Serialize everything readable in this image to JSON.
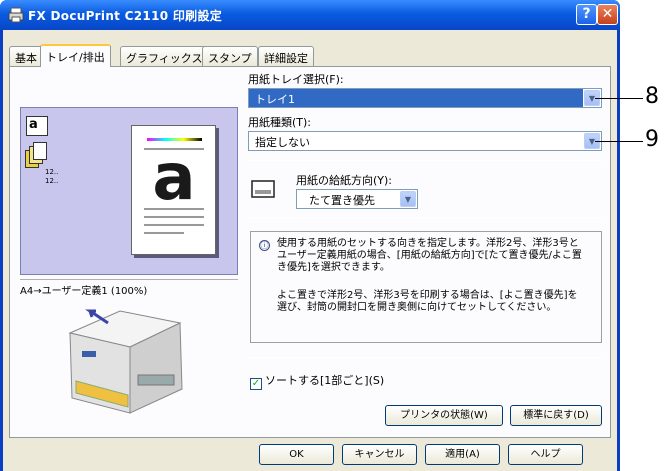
{
  "window": {
    "title": "FX DocuPrint C2110 印刷設定",
    "help_button": "?",
    "close_button": "✕"
  },
  "tabs": [
    {
      "label": "基本",
      "active": false
    },
    {
      "label": "トレイ/排出",
      "active": true
    },
    {
      "label": "グラフィックス",
      "active": false
    },
    {
      "label": "スタンプ",
      "active": false
    },
    {
      "label": "詳細設定",
      "active": false
    }
  ],
  "preview": {
    "caption": "A4→ユーザー定義1 (100%)",
    "big_letter": "a",
    "small_labels": [
      "12..",
      "12.."
    ]
  },
  "paper_tray": {
    "label": "用紙トレイ選択(F):",
    "value": "トレイ1"
  },
  "paper_type": {
    "label": "用紙種類(T):",
    "value": "指定しない"
  },
  "feed_direction": {
    "label": "用紙の給紙方向(Y):",
    "value": "たて置き優先"
  },
  "info": {
    "icon": "ⓘ",
    "paragraph1": "使用する用紙のセットする向きを指定します。洋形2号、洋形3号とユーザー定義用紙の場合、[用紙の給紙方向]で[たて置き優先/よこ置き優先]を選択できます。",
    "paragraph2": "よこ置きで洋形2号、洋形3号を印刷する場合は、[よこ置き優先]を選び、封筒の開封口を開き奥側に向けてセットしてください。"
  },
  "collate": {
    "label": "ソートする[1部ごと](S)",
    "checked": true
  },
  "buttons": {
    "printer_status": "プリンタの状態(W)",
    "reset": "標準に戻す(D)",
    "ok": "OK",
    "cancel": "キャンセル",
    "apply": "適用(A)",
    "help": "ヘルプ"
  },
  "callouts": [
    "8",
    "9"
  ],
  "colors": {
    "titlebar": "#0a5ce0",
    "preview_bg": "#c9c6ee",
    "selection": "#316ac5"
  }
}
